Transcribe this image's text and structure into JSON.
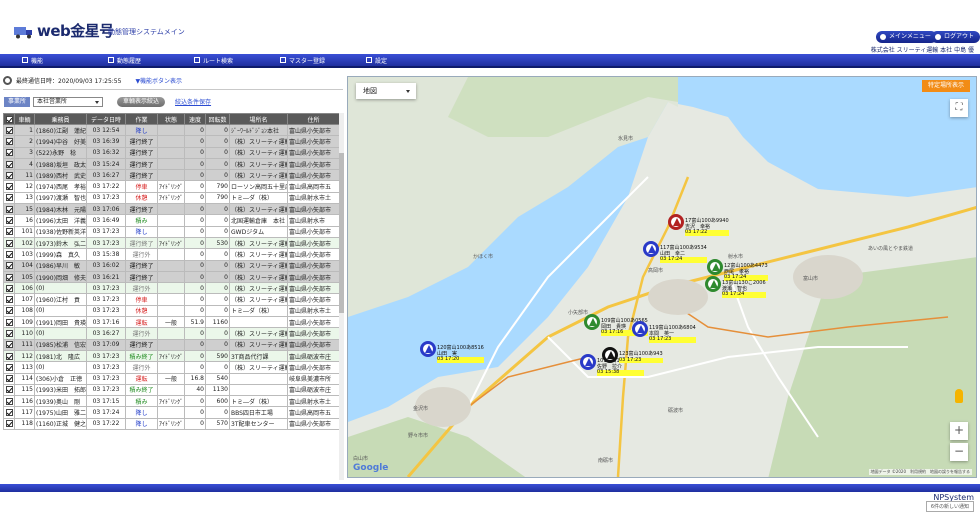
{
  "header": {
    "logo": "web金星号",
    "system_title": "動態管理システムメイン",
    "main_menu": "メインメニュー",
    "logout": "ログアウト",
    "user_info": "株式会社 スリーティ運輸 本社 中島 優"
  },
  "nav": [
    "機能",
    "動態履歴",
    "ルート検索",
    "マスター登録",
    "設定"
  ],
  "status": {
    "last_comm": "最終通信日時：2020/09/03 17:25:55",
    "toggle_link": "▼機能ボタン表示"
  },
  "filter": {
    "office_label": "事業所",
    "office_value": "本社営業所",
    "filter_button": "車輌表示絞込",
    "save_link": "絞込条件保存"
  },
  "table": {
    "headers": [
      "",
      "車輌",
      "乗務員",
      "データ日時",
      "作業",
      "状態",
      "速度",
      "回転数",
      "場所名",
      "住所"
    ],
    "rows": [
      {
        "on": true,
        "cls": "g",
        "no": "1",
        "driver": "(1860)江副　蓮紀",
        "time": "03 12:54",
        "work": "降し",
        "wc": "blue",
        "state": "",
        "speed": "0",
        "rpm": "0",
        "place": "ｼﾞｰﾜｰﾙﾄﾞｼﾞｮﾝ本社",
        "addr": "富山県小矢部市"
      },
      {
        "on": true,
        "cls": "g",
        "no": "2",
        "driver": "(1994)中谷　好美",
        "time": "03 16:39",
        "work": "運行終了",
        "wc": "dk",
        "state": "",
        "speed": "0",
        "rpm": "0",
        "place": "（株）スリーティ運輸",
        "addr": "富山県小矢部市"
      },
      {
        "on": true,
        "cls": "g",
        "no": "3",
        "driver": "(522)永野　稔",
        "time": "03 16:32",
        "work": "運行終了",
        "wc": "dk",
        "state": "",
        "speed": "0",
        "rpm": "0",
        "place": "（株）スリーティ運輸",
        "addr": "富山県小矢部市"
      },
      {
        "on": true,
        "cls": "g",
        "no": "4",
        "driver": "(1988)坂垣　政太",
        "time": "03 15:24",
        "work": "運行終了",
        "wc": "dk",
        "state": "",
        "speed": "0",
        "rpm": "0",
        "place": "（株）スリーティ運輸",
        "addr": "富山県小矢部市"
      },
      {
        "on": true,
        "cls": "g",
        "no": "11",
        "driver": "(1989)西村　武史",
        "time": "03 16:27",
        "work": "運行終了",
        "wc": "dk",
        "state": "",
        "speed": "0",
        "rpm": "0",
        "place": "（株）スリーティ運輸",
        "addr": "富山県小矢部市"
      },
      {
        "on": true,
        "cls": "w",
        "no": "12",
        "driver": "(1974)西尾　孝裕",
        "time": "03 17:22",
        "work": "停車",
        "wc": "red",
        "state": "ｱｲﾄﾞﾘﾝｸﾞ",
        "speed": "0",
        "rpm": "790",
        "place": "ローソン高岡五十里店",
        "addr": "富山県高岡市五"
      },
      {
        "on": true,
        "cls": "w",
        "no": "13",
        "driver": "(1997)渡瀬　智也",
        "time": "03 17:23",
        "work": "休憩",
        "wc": "red",
        "state": "ｱｲﾄﾞﾘﾝｸﾞ",
        "speed": "0",
        "rpm": "790",
        "place": "トミ―ダ（株）",
        "addr": "富山県射水市土"
      },
      {
        "on": true,
        "cls": "g",
        "no": "15",
        "driver": "(1984)木林　元陽",
        "time": "03 17:06",
        "work": "運行終了",
        "wc": "dk",
        "state": "",
        "speed": "0",
        "rpm": "0",
        "place": "（株）スリーティ運輸",
        "addr": "富山県小矢部市"
      },
      {
        "on": true,
        "cls": "w",
        "no": "16",
        "driver": "(1996)太田　洋義",
        "time": "03 16:49",
        "work": "積み",
        "wc": "green",
        "state": "",
        "speed": "0",
        "rpm": "0",
        "place": "北国運輸倉庫　本社",
        "addr": "富山県射水市"
      },
      {
        "on": true,
        "cls": "w",
        "no": "101",
        "driver": "(1938)佐野新英洋",
        "time": "03 17:23",
        "work": "降し",
        "wc": "blue",
        "state": "",
        "speed": "0",
        "rpm": "0",
        "place": "GWDジタム",
        "addr": "富山県小矢部市"
      },
      {
        "on": true,
        "cls": "t",
        "no": "102",
        "driver": "(1973)鈴木　弘二",
        "time": "03 17:23",
        "work": "運行終了",
        "wc": "gray",
        "state": "ｱｲﾄﾞﾘﾝｸﾞ",
        "speed": "0",
        "rpm": "530",
        "place": "（株）スリーティ運輸",
        "addr": "富山県小矢部市"
      },
      {
        "on": true,
        "cls": "w",
        "no": "103",
        "driver": "(1999)森　真久",
        "time": "03 15:38",
        "work": "運行外",
        "wc": "gray",
        "state": "",
        "speed": "0",
        "rpm": "0",
        "place": "（株）スリーティ運輸",
        "addr": "富山県小矢部市"
      },
      {
        "on": true,
        "cls": "g",
        "no": "104",
        "driver": "(1986)早川　敏",
        "time": "03 16:02",
        "work": "運行終了",
        "wc": "dk",
        "state": "",
        "speed": "0",
        "rpm": "0",
        "place": "（株）スリーティ運輸",
        "addr": "富山県小矢部市"
      },
      {
        "on": true,
        "cls": "g",
        "no": "105",
        "driver": "(1990)岡畑　修夫",
        "time": "03 16:21",
        "work": "運行終了",
        "wc": "dk",
        "state": "",
        "speed": "0",
        "rpm": "0",
        "place": "（株）スリーティ運輸",
        "addr": "富山県小矢部市"
      },
      {
        "on": true,
        "cls": "t",
        "no": "106",
        "driver": "(0)",
        "time": "03 17:23",
        "work": "運行外",
        "wc": "gray",
        "state": "",
        "speed": "0",
        "rpm": "0",
        "place": "（株）スリーティ運輸",
        "addr": "富山県小矢部市"
      },
      {
        "on": true,
        "cls": "w",
        "no": "107",
        "driver": "(1960)江村　貢",
        "time": "03 17:23",
        "work": "停車",
        "wc": "red",
        "state": "",
        "speed": "0",
        "rpm": "0",
        "place": "（株）スリーティ運輸",
        "addr": "富山県小矢部市"
      },
      {
        "on": true,
        "cls": "w",
        "no": "108",
        "driver": "(0)",
        "time": "03 17:23",
        "work": "休憩",
        "wc": "red",
        "state": "",
        "speed": "0",
        "rpm": "0",
        "place": "トミ―ダ（株）",
        "addr": "富山県射水市土"
      },
      {
        "on": true,
        "cls": "w",
        "no": "109",
        "driver": "(1991)岡田　貴瑛",
        "time": "03 17:16",
        "work": "運転",
        "wc": "red",
        "state": "一般",
        "speed": "51.9",
        "rpm": "1160",
        "place": "",
        "addr": "富山県小矢部市"
      },
      {
        "on": true,
        "cls": "t",
        "no": "110",
        "driver": "(0)",
        "time": "03 16:27",
        "work": "運行外",
        "wc": "gray",
        "state": "",
        "speed": "0",
        "rpm": "0",
        "place": "（株）スリーティ運輸",
        "addr": "富山県小矢部市"
      },
      {
        "on": true,
        "cls": "g",
        "no": "111",
        "driver": "(1985)松浦　信宏",
        "time": "03 17:09",
        "work": "運行終了",
        "wc": "dk",
        "state": "",
        "speed": "0",
        "rpm": "0",
        "place": "（株）スリーティ運輸",
        "addr": "富山県小矢部市"
      },
      {
        "on": true,
        "cls": "t",
        "no": "112",
        "driver": "(1981)北　隆広",
        "time": "03 17:23",
        "work": "積み終了",
        "wc": "green",
        "state": "ｱｲﾄﾞﾘﾝｸﾞ",
        "speed": "0",
        "rpm": "590",
        "place": "3T商品代行課",
        "addr": "富山県砺波市庄"
      },
      {
        "on": true,
        "cls": "w",
        "no": "113",
        "driver": "(0)",
        "time": "03 17:23",
        "work": "運行外",
        "wc": "gray",
        "state": "",
        "speed": "0",
        "rpm": "0",
        "place": "（株）スリーティ運輸",
        "addr": "富山県小矢部市"
      },
      {
        "on": true,
        "cls": "w",
        "no": "114",
        "driver": "(306)小倉　正徳",
        "time": "03 17:23",
        "work": "運転",
        "wc": "red",
        "state": "一般",
        "speed": "16.8",
        "rpm": "540",
        "place": "",
        "addr": "岐阜県美濃市所"
      },
      {
        "on": true,
        "cls": "w",
        "no": "115",
        "driver": "(1993)米田　拓郎",
        "time": "03 17:23",
        "work": "積み終了",
        "wc": "green",
        "state": "",
        "speed": "40",
        "rpm": "1130",
        "place": "",
        "addr": "富山県砺波市庄"
      },
      {
        "on": true,
        "cls": "w",
        "no": "116",
        "driver": "(1939)奥山　剛",
        "time": "03 17:15",
        "work": "積み",
        "wc": "green",
        "state": "ｱｲﾄﾞﾘﾝｸﾞ",
        "speed": "0",
        "rpm": "600",
        "place": "トミ―ダ（株）",
        "addr": "富山県射水市土"
      },
      {
        "on": true,
        "cls": "w",
        "no": "117",
        "driver": "(1975)山田　雅二",
        "time": "03 17:24",
        "work": "降し",
        "wc": "blue",
        "state": "",
        "speed": "0",
        "rpm": "0",
        "place": "BBS四日市工場",
        "addr": "富山県高岡市五"
      },
      {
        "on": true,
        "cls": "w",
        "no": "118",
        "driver": "(1160)正城　健之",
        "time": "03 17:22",
        "work": "降し",
        "wc": "blue",
        "state": "ｱｲﾄﾞﾘﾝｸﾞ",
        "speed": "0",
        "rpm": "570",
        "place": "3T配車センター",
        "addr": "富山県小矢部市"
      }
    ]
  },
  "map": {
    "type_selector": "地図",
    "point_button": "特定場所表示",
    "google": "Google",
    "attribution": "地図データ ©2020　利用規約　地図の誤りを報告する",
    "cities": [
      "氷見市",
      "かほく市",
      "小矢部市",
      "射水市",
      "富山市",
      "高岡市",
      "砺波市",
      "金沢市",
      "野々市市",
      "白山市",
      "南砺市",
      "あいの風とやま鉄道"
    ],
    "markers": [
      {
        "color": "#b22222",
        "text": "17富山100あ9940",
        "sub": "吉沢　幸裕",
        "time": "03 17:22"
      },
      {
        "color": "#2a3ac8",
        "text": "117富山100あ9534",
        "sub": "山田　幸二",
        "time": "03 17:24"
      },
      {
        "color": "#2f8a2f",
        "text": "12富山100あ4473",
        "sub": "西尾　孝裕",
        "time": "03 17:24"
      },
      {
        "color": "#2f8a2f",
        "text": "13富山130こ2006",
        "sub": "渡瀬　智也",
        "time": "03 17:24"
      },
      {
        "color": "#2f8a2f",
        "text": "109富山100あ0565",
        "sub": "岡田　貴瑛",
        "time": "03 17:16"
      },
      {
        "color": "#2a3ac8",
        "text": "119富山100あ6804",
        "sub": "本間　英一",
        "time": "03 17:23"
      },
      {
        "color": "#2a3ac8",
        "text": "120富山100あ8516",
        "sub": "山田　実",
        "time": "03 17:20"
      },
      {
        "color": "#2a3ac8",
        "text": "101富山100あ4920",
        "sub": "佐野　拉介",
        "time": "03 15:38"
      },
      {
        "color": "#111111",
        "text": "123富山100あ943",
        "sub": "",
        "time": "03 17:23"
      }
    ]
  },
  "footer": {
    "brand": "NPSystem",
    "update_btn": "6件の新しい通知"
  }
}
